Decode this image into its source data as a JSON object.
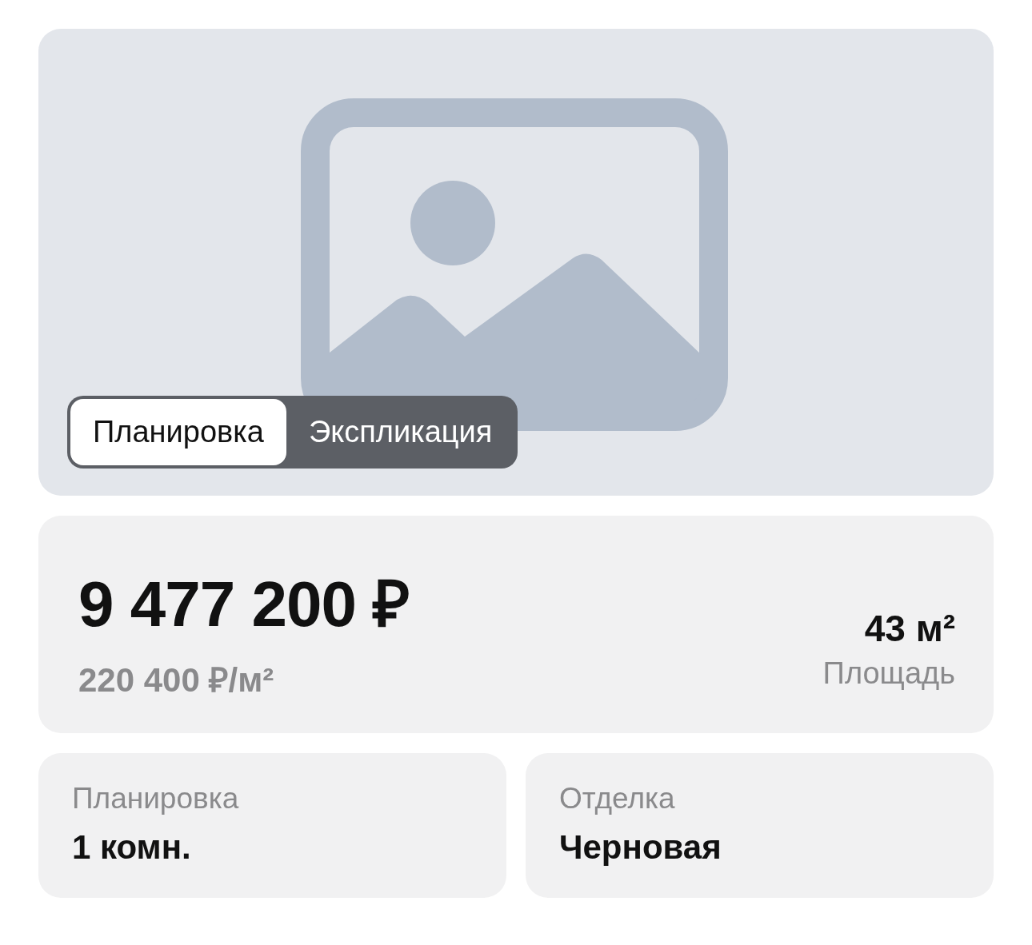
{
  "tabs": [
    {
      "label": "Планировка",
      "selected": true
    },
    {
      "label": "Экспликация",
      "selected": false
    }
  ],
  "price": {
    "total": "9 477 200 ₽",
    "per_meter": "220 400 ₽/м²"
  },
  "area": {
    "value": "43 м²",
    "label": "Площадь"
  },
  "details": [
    {
      "label": "Планировка",
      "value": "1 комн."
    },
    {
      "label": "Отделка",
      "value": "Черновая"
    }
  ]
}
